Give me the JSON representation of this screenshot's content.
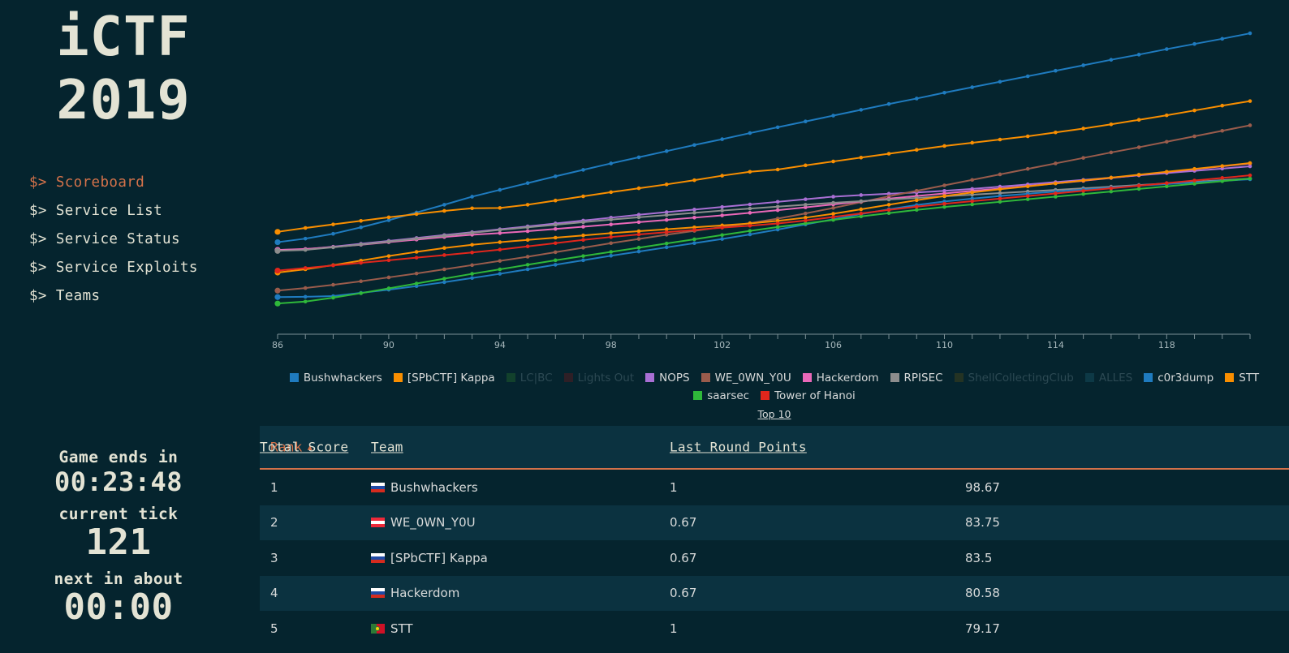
{
  "brand": {
    "line1": "iCTF",
    "line2": "2019"
  },
  "nav": {
    "prompt": "$>",
    "items": [
      {
        "label": "Scoreboard",
        "active": true
      },
      {
        "label": "Service List",
        "active": false
      },
      {
        "label": "Service Status",
        "active": false
      },
      {
        "label": "Service Exploits",
        "active": false
      },
      {
        "label": "Teams",
        "active": false
      }
    ]
  },
  "timers": {
    "game_ends_label": "Game ends in",
    "game_ends_value": "00:23:48",
    "current_tick_label": "current tick",
    "current_tick_value": "121",
    "next_in_label": "next in about",
    "next_in_value": "00:00"
  },
  "legend": {
    "top10_label": "Top 10",
    "items": [
      {
        "label": "Bushwhackers",
        "color": "#1f7bbf",
        "enabled": true
      },
      {
        "label": "[SPbCTF] Kappa",
        "color": "#f98e00",
        "enabled": true
      },
      {
        "label": "LC|BC",
        "color": "#12412c",
        "enabled": false
      },
      {
        "label": "Lights Out",
        "color": "#2e1f26",
        "enabled": false
      },
      {
        "label": "NOPS",
        "color": "#a96fd4",
        "enabled": true
      },
      {
        "label": "WE_0WN_Y0U",
        "color": "#9a5c4c",
        "enabled": true
      },
      {
        "label": "Hackerdom",
        "color": "#e968b8",
        "enabled": true
      },
      {
        "label": "RPISEC",
        "color": "#8d8d8d",
        "enabled": true
      },
      {
        "label": "ShellCollectingClub",
        "color": "#243323",
        "enabled": false
      },
      {
        "label": "ALLES",
        "color": "#0d3946",
        "enabled": false
      },
      {
        "label": "c0r3dump",
        "color": "#1f7bbf",
        "enabled": true
      },
      {
        "label": "STT",
        "color": "#f98e00",
        "enabled": true
      },
      {
        "label": "saarsec",
        "color": "#2fb83a",
        "enabled": true
      },
      {
        "label": "Tower of Hanoi",
        "color": "#e1261c",
        "enabled": true
      }
    ]
  },
  "table": {
    "columns": [
      {
        "key": "rank",
        "label": "Rank",
        "sorted": true,
        "caret": "▲"
      },
      {
        "key": "team",
        "label": "Team",
        "sorted": false,
        "caret": ""
      },
      {
        "key": "lrp",
        "label": "Last Round Points",
        "sorted": false,
        "caret": ""
      },
      {
        "key": "total",
        "label": "Total Score",
        "sorted": false,
        "caret": ""
      }
    ],
    "rows": [
      {
        "rank": "1",
        "flag": "ru",
        "team": "Bushwhackers",
        "lrp": "1",
        "total": "98.67"
      },
      {
        "rank": "2",
        "flag": "at",
        "team": "WE_0WN_Y0U",
        "lrp": "0.67",
        "total": "83.75"
      },
      {
        "rank": "3",
        "flag": "ru",
        "team": "[SPbCTF] Kappa",
        "lrp": "0.67",
        "total": "83.5"
      },
      {
        "rank": "4",
        "flag": "ru",
        "team": "Hackerdom",
        "lrp": "0.67",
        "total": "80.58"
      },
      {
        "rank": "5",
        "flag": "pt",
        "team": "STT",
        "lrp": "1",
        "total": "79.17"
      }
    ]
  },
  "chart_data": {
    "type": "line",
    "title": "",
    "xlabel": "",
    "ylabel": "",
    "grid": false,
    "legend_position": "bottom",
    "xlim": [
      86,
      121
    ],
    "ylim": [
      0,
      100
    ],
    "xticks": [
      86,
      90,
      94,
      98,
      102,
      106,
      110,
      114,
      118
    ],
    "x": [
      86,
      87,
      88,
      89,
      90,
      91,
      92,
      93,
      94,
      95,
      96,
      97,
      98,
      99,
      100,
      101,
      102,
      103,
      104,
      105,
      106,
      107,
      108,
      109,
      110,
      111,
      112,
      113,
      114,
      115,
      116,
      117,
      118,
      119,
      120,
      121
    ],
    "series": [
      {
        "name": "Bushwhackers",
        "color": "#1f7bbf",
        "visible": true,
        "values": [
          28.0,
          29.1,
          30.6,
          32.6,
          34.8,
          37.2,
          39.6,
          42.1,
          44.2,
          46.3,
          48.4,
          50.4,
          52.4,
          54.3,
          56.2,
          58.1,
          59.9,
          61.8,
          63.6,
          65.4,
          67.2,
          69.0,
          70.8,
          72.5,
          74.3,
          76.0,
          77.7,
          79.4,
          81.1,
          82.8,
          84.5,
          86.1,
          87.8,
          89.4,
          91.0,
          92.7
        ]
      },
      {
        "name": "[SPbCTF] Kappa",
        "color": "#f98e00",
        "visible": true,
        "values": [
          31.2,
          32.4,
          33.5,
          34.6,
          35.7,
          36.7,
          37.7,
          38.5,
          38.6,
          39.6,
          40.9,
          42.2,
          43.5,
          44.7,
          45.9,
          47.2,
          48.6,
          49.8,
          50.5,
          51.8,
          53.0,
          54.2,
          55.4,
          56.6,
          57.8,
          58.8,
          59.8,
          60.8,
          62.0,
          63.2,
          64.5,
          65.9,
          67.3,
          68.8,
          70.3,
          71.7
        ]
      },
      {
        "name": "LC|BC",
        "color": "#12412c",
        "visible": false,
        "values": []
      },
      {
        "name": "Lights Out",
        "color": "#2e1f26",
        "visible": false,
        "values": []
      },
      {
        "name": "NOPS",
        "color": "#a96fd4",
        "visible": true,
        "values": [
          25.6,
          25.8,
          26.6,
          27.5,
          28.4,
          29.3,
          30.2,
          31.1,
          32.0,
          32.9,
          33.8,
          34.7,
          35.6,
          36.5,
          37.3,
          38.1,
          38.9,
          39.7,
          40.5,
          41.3,
          42.1,
          42.6,
          43.0,
          43.4,
          43.9,
          44.5,
          45.2,
          45.9,
          46.6,
          47.3,
          48.0,
          48.7,
          49.4,
          50.1,
          50.8,
          51.5
        ]
      },
      {
        "name": "WE_0WN_Y0U",
        "color": "#9a5c4c",
        "visible": true,
        "values": [
          13.0,
          13.8,
          14.8,
          15.9,
          17.1,
          18.3,
          19.6,
          20.9,
          22.2,
          23.5,
          24.9,
          26.3,
          27.7,
          29.0,
          30.3,
          31.5,
          32.7,
          33.9,
          35.3,
          36.9,
          38.6,
          40.4,
          42.2,
          43.9,
          45.6,
          47.3,
          49.0,
          50.7,
          52.4,
          54.1,
          55.8,
          57.4,
          59.1,
          60.8,
          62.5,
          64.2
        ]
      },
      {
        "name": "Hackerdom",
        "color": "#e968b8",
        "visible": true,
        "values": [
          25.6,
          25.9,
          26.5,
          27.2,
          28.0,
          28.8,
          29.6,
          30.3,
          30.8,
          31.4,
          32.1,
          32.8,
          33.5,
          34.2,
          34.9,
          35.6,
          36.3,
          37.1,
          37.9,
          38.8,
          39.7,
          40.6,
          41.5,
          42.3,
          43.1,
          43.9,
          44.6,
          45.4,
          46.2,
          47.0,
          47.9,
          48.8,
          49.7,
          50.6,
          51.5,
          52.4
        ]
      },
      {
        "name": "RPISEC",
        "color": "#8d8d8d",
        "visible": true,
        "values": [
          25.3,
          25.6,
          26.4,
          27.3,
          28.2,
          29.1,
          30.0,
          30.9,
          31.8,
          32.6,
          33.4,
          34.2,
          35.0,
          35.7,
          36.4,
          37.1,
          37.8,
          38.4,
          39.0,
          39.6,
          40.2,
          40.7,
          41.2,
          41.7,
          42.2,
          42.7,
          43.2,
          43.7,
          44.2,
          44.7,
          45.2,
          45.7,
          46.2,
          46.7,
          47.2,
          47.7
        ]
      },
      {
        "name": "ShellCollectingClub",
        "color": "#243323",
        "visible": false,
        "values": []
      },
      {
        "name": "ALLES",
        "color": "#0d3946",
        "visible": false,
        "values": []
      },
      {
        "name": "c0r3dump",
        "color": "#1f7bbf",
        "visible": true,
        "values": [
          11.0,
          11.1,
          11.3,
          12.3,
          13.3,
          14.4,
          15.6,
          16.9,
          18.2,
          19.6,
          21.0,
          22.4,
          23.8,
          25.1,
          26.4,
          27.7,
          29.0,
          30.4,
          31.9,
          33.5,
          35.1,
          36.7,
          38.2,
          39.5,
          40.6,
          41.5,
          42.3,
          43.0,
          43.7,
          44.3,
          44.9,
          45.5,
          46.0,
          46.5,
          47.0,
          47.5
        ]
      },
      {
        "name": "STT",
        "color": "#f98e00",
        "visible": true,
        "values": [
          18.6,
          19.6,
          20.9,
          22.3,
          23.7,
          25.0,
          26.2,
          27.2,
          28.0,
          28.7,
          29.4,
          30.1,
          30.8,
          31.4,
          32.0,
          32.6,
          33.2,
          33.8,
          34.6,
          35.6,
          36.8,
          38.2,
          39.6,
          41.0,
          42.3,
          43.4,
          44.4,
          45.3,
          46.2,
          47.1,
          48.0,
          48.9,
          49.8,
          50.7,
          51.6,
          52.5
        ]
      },
      {
        "name": "saarsec",
        "color": "#2fb83a",
        "visible": true,
        "values": [
          9.0,
          9.6,
          10.8,
          12.2,
          13.7,
          15.2,
          16.7,
          18.2,
          19.6,
          21.0,
          22.4,
          23.7,
          25.0,
          26.3,
          27.6,
          28.9,
          30.2,
          31.5,
          32.7,
          33.8,
          34.9,
          36.0,
          37.0,
          38.0,
          38.9,
          39.7,
          40.5,
          41.3,
          42.1,
          42.9,
          43.7,
          44.5,
          45.3,
          46.1,
          46.9,
          47.7
        ]
      },
      {
        "name": "Tower of Hanoi",
        "color": "#e1261c",
        "visible": true,
        "values": [
          19.2,
          20.0,
          20.8,
          21.6,
          22.4,
          23.2,
          24.0,
          24.8,
          25.7,
          26.7,
          27.7,
          28.7,
          29.6,
          30.4,
          31.1,
          31.8,
          32.5,
          33.1,
          33.8,
          34.7,
          35.8,
          36.9,
          38.0,
          39.0,
          39.9,
          40.7,
          41.5,
          42.3,
          43.1,
          43.9,
          44.7,
          45.5,
          46.3,
          47.1,
          47.9,
          48.7
        ]
      }
    ]
  }
}
